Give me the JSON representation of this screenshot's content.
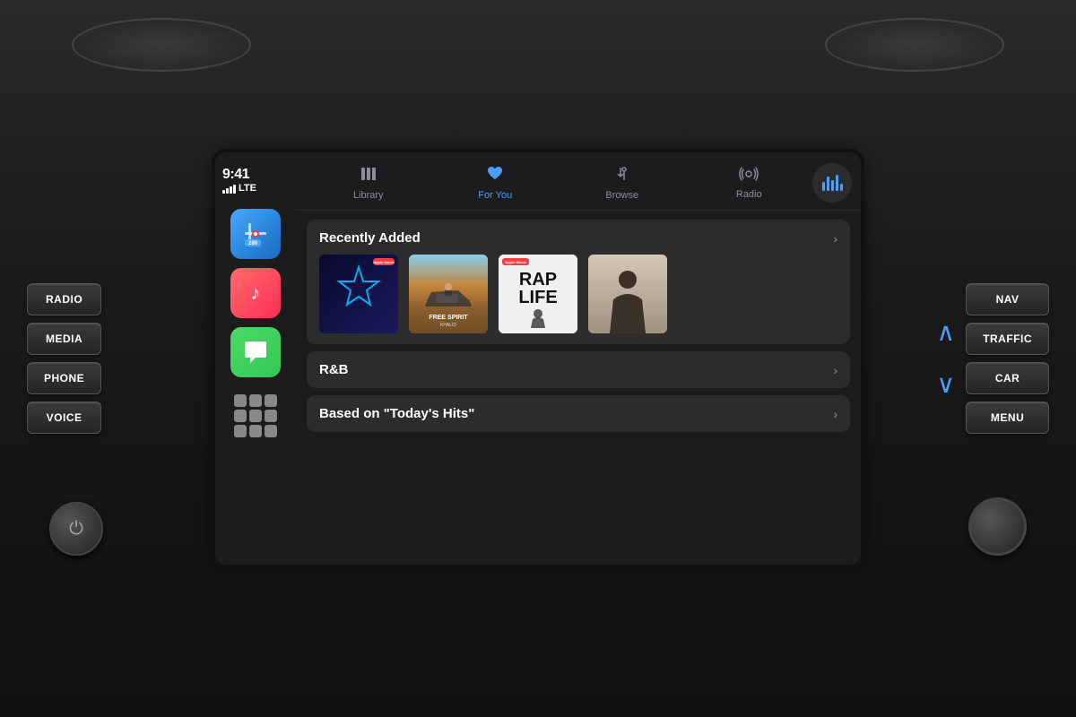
{
  "car": {
    "left_buttons": [
      {
        "id": "radio",
        "label": "RADIO"
      },
      {
        "id": "media",
        "label": "MEDIA"
      },
      {
        "id": "phone",
        "label": "PHONE"
      },
      {
        "id": "voice",
        "label": "VOICE"
      }
    ],
    "right_buttons": [
      {
        "id": "nav",
        "label": "NAV"
      },
      {
        "id": "traffic",
        "label": "TRAFFIC"
      },
      {
        "id": "car",
        "label": "CAR"
      },
      {
        "id": "menu",
        "label": "MENU"
      }
    ]
  },
  "screen": {
    "status": {
      "time": "9:41",
      "signal": "LTE"
    },
    "tabs": [
      {
        "id": "library",
        "label": "Library",
        "icon": "🗂",
        "active": false
      },
      {
        "id": "for-you",
        "label": "For You",
        "icon": "♥",
        "active": true
      },
      {
        "id": "browse",
        "label": "Browse",
        "icon": "♪",
        "active": false
      },
      {
        "id": "radio",
        "label": "Radio",
        "icon": "📡",
        "active": false
      }
    ],
    "sections": [
      {
        "id": "recently-added",
        "title": "Recently Added",
        "albums": [
          {
            "id": "star",
            "style": "star",
            "name": "Star Album"
          },
          {
            "id": "khalid",
            "style": "khalid",
            "name": "Free Spirit - Khalid"
          },
          {
            "id": "raplife",
            "style": "raplife",
            "name": "Rap Life"
          },
          {
            "id": "shadow",
            "style": "shadow",
            "name": "Shadow Album"
          }
        ]
      },
      {
        "id": "rnb",
        "title": "R&B"
      },
      {
        "id": "todays-hits",
        "title": "Based on \"Today's Hits\""
      }
    ],
    "apps": [
      {
        "id": "maps",
        "type": "maps"
      },
      {
        "id": "music",
        "type": "music"
      },
      {
        "id": "messages",
        "type": "messages"
      }
    ]
  }
}
